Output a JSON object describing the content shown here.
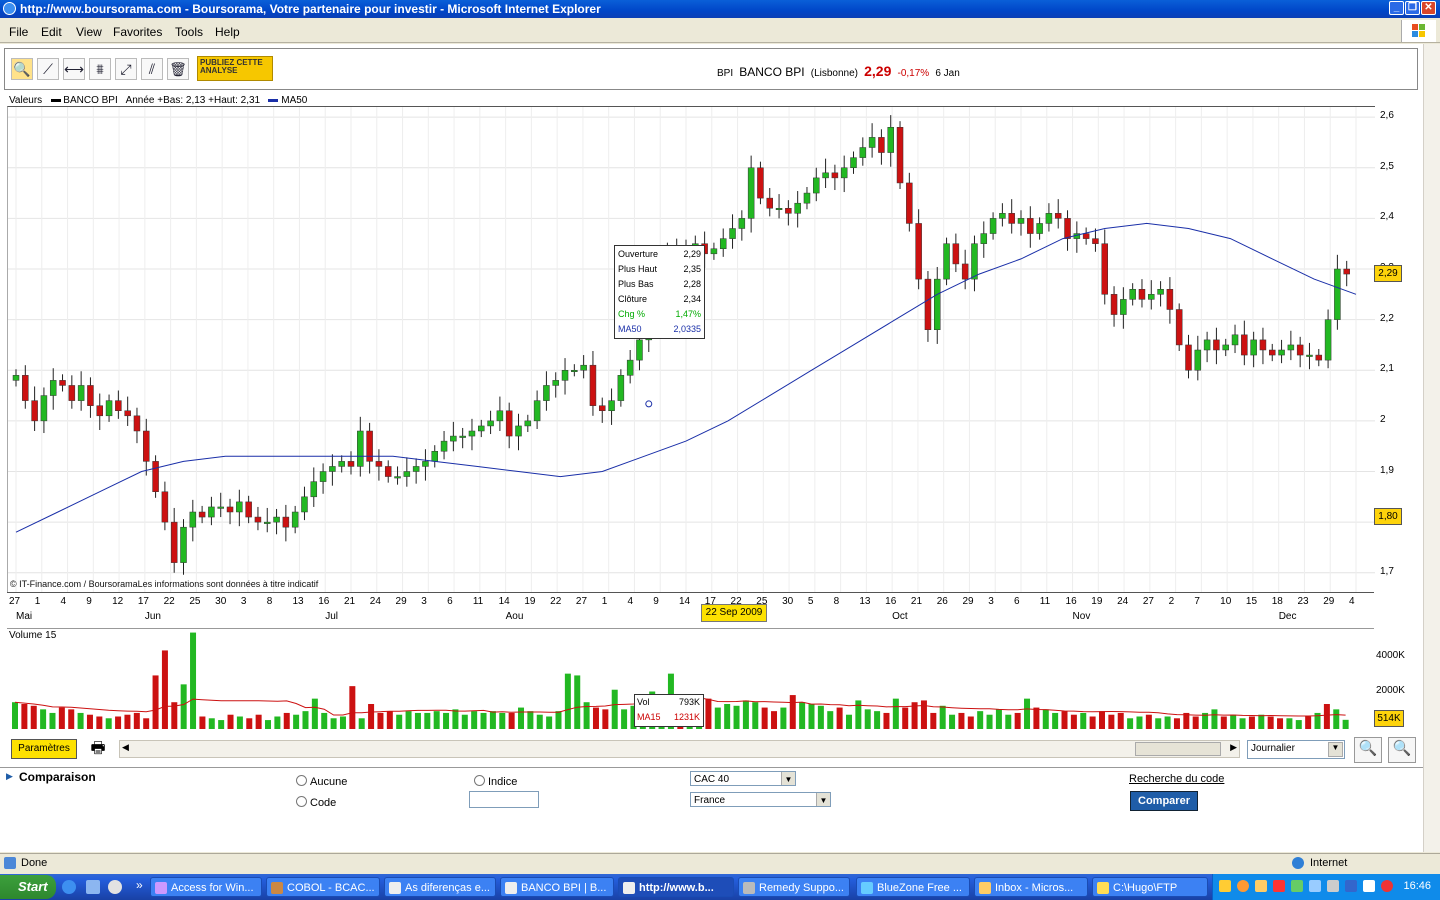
{
  "window": {
    "title": "http://www.boursorama.com - Boursorama, Votre partenaire pour investir - Microsoft Internet Explorer"
  },
  "menu": [
    "File",
    "Edit",
    "View",
    "Favorites",
    "Tools",
    "Help"
  ],
  "toolbar": {
    "publiez_label": "PUBLIEZ CETTE ANALYSE"
  },
  "header": {
    "ticker": "BPI",
    "name": "BANCO BPI",
    "market": "(Lisbonne)",
    "price": "2,29",
    "change": "-0,17%",
    "date": "6 Jan"
  },
  "legend": {
    "valeurs": "Valeurs",
    "series_name": "BANCO BPI",
    "range": "Année +Bas: 2,13 +Haut: 2,31",
    "ma_name": "MA50"
  },
  "copyright": "© IT-Finance.com / BoursoramaLes informations sont données à titre indicatif",
  "tooltip": {
    "rows": [
      {
        "label": "Ouverture",
        "value": "2,29"
      },
      {
        "label": "Plus Haut",
        "value": "2,35"
      },
      {
        "label": "Plus Bas",
        "value": "2,28"
      },
      {
        "label": "Clôture",
        "value": "2,34"
      },
      {
        "label": "Chg %",
        "value": "1,47%"
      },
      {
        "label": "MA50",
        "value": "2,0335"
      }
    ]
  },
  "date_flag": "22 Sep 2009",
  "price_tags": {
    "last": "2,29",
    "low": "1,80"
  },
  "volume": {
    "title": "Volume 15",
    "axis": [
      "4000K",
      "2000K"
    ],
    "tag": "514K",
    "tip_vol_label": "Vol",
    "tip_vol": "793K",
    "tip_ma_label": "MA15",
    "tip_ma": "1231K"
  },
  "chart_data": {
    "type": "candlestick",
    "title": "",
    "y_ticks": [
      "2,6",
      "2,5",
      "2,4",
      "2,3",
      "2,2",
      "2,1",
      "2",
      "1,9",
      "1,8",
      "1,7"
    ],
    "ylim": [
      1.66,
      2.62
    ],
    "x_day_ticks": [
      "27",
      "1",
      "4",
      "9",
      "12",
      "17",
      "22",
      "25",
      "30",
      "3",
      "8",
      "13",
      "16",
      "21",
      "24",
      "29",
      "3",
      "6",
      "11",
      "14",
      "19",
      "22",
      "27",
      "1",
      "4",
      "9",
      "14",
      "17",
      "22",
      "25",
      "30",
      "5",
      "8",
      "13",
      "16",
      "21",
      "26",
      "29",
      "3",
      "6",
      "11",
      "16",
      "19",
      "24",
      "27",
      "2",
      "7",
      "10",
      "15",
      "18",
      "23",
      "29",
      "4"
    ],
    "months": [
      "Mai",
      "Jun",
      "Jul",
      "Aou",
      "Se",
      "Oct",
      "Nov",
      "Dec"
    ],
    "close_series": [
      2.09,
      2.04,
      2.0,
      2.05,
      2.08,
      2.07,
      2.04,
      2.07,
      2.03,
      2.01,
      2.04,
      2.02,
      2.01,
      1.98,
      1.92,
      1.86,
      1.8,
      1.72,
      1.79,
      1.82,
      1.81,
      1.83,
      1.83,
      1.82,
      1.84,
      1.81,
      1.8,
      1.8,
      1.81,
      1.79,
      1.82,
      1.85,
      1.88,
      1.9,
      1.91,
      1.92,
      1.91,
      1.98,
      1.92,
      1.91,
      1.89,
      1.89,
      1.9,
      1.91,
      1.92,
      1.94,
      1.96,
      1.97,
      1.97,
      1.98,
      1.99,
      2.0,
      2.02,
      1.97,
      1.99,
      2.0,
      2.04,
      2.07,
      2.08,
      2.1,
      2.1,
      2.11,
      2.03,
      2.02,
      2.04,
      2.09,
      2.12,
      2.16,
      2.22,
      2.3,
      2.34,
      2.3,
      2.33,
      2.35,
      2.33,
      2.34,
      2.36,
      2.38,
      2.4,
      2.5,
      2.44,
      2.42,
      2.42,
      2.41,
      2.43,
      2.45,
      2.48,
      2.49,
      2.48,
      2.5,
      2.52,
      2.54,
      2.56,
      2.53,
      2.58,
      2.47,
      2.39,
      2.28,
      2.18,
      2.28,
      2.35,
      2.31,
      2.28,
      2.35,
      2.37,
      2.4,
      2.41,
      2.39,
      2.4,
      2.37,
      2.39,
      2.41,
      2.4,
      2.36,
      2.37,
      2.36,
      2.35,
      2.25,
      2.21,
      2.24,
      2.26,
      2.24,
      2.25,
      2.26,
      2.22,
      2.15,
      2.1,
      2.14,
      2.16,
      2.14,
      2.15,
      2.17,
      2.13,
      2.16,
      2.14,
      2.13,
      2.14,
      2.15,
      2.13,
      2.13,
      2.12,
      2.2,
      2.3,
      2.29
    ],
    "ma50_series": [
      1.78,
      1.82,
      1.86,
      1.9,
      1.92,
      1.93,
      1.93,
      1.93,
      1.93,
      1.93,
      1.92,
      1.91,
      1.9,
      1.89,
      1.9,
      1.93,
      1.96,
      2.0,
      2.05,
      2.1,
      2.15,
      2.2,
      2.25,
      2.29,
      2.32,
      2.36,
      2.38,
      2.39,
      2.38,
      2.36,
      2.32,
      2.28,
      2.25
    ],
    "volume_series_k": [
      1500,
      1400,
      1300,
      1100,
      900,
      1200,
      1100,
      900,
      800,
      700,
      600,
      700,
      800,
      900,
      600,
      3000,
      4400,
      1500,
      2500,
      5400,
      700,
      600,
      500,
      800,
      700,
      600,
      800,
      500,
      700,
      900,
      800,
      1000,
      1700,
      900,
      600,
      700,
      2400,
      600,
      1400,
      900,
      1000,
      800,
      1000,
      900,
      900,
      1000,
      900,
      1100,
      800,
      1000,
      900,
      1000,
      900,
      900,
      1200,
      1000,
      800,
      700,
      1000,
      3100,
      3000,
      1500,
      1200,
      1100,
      2200,
      1100,
      1300,
      1500,
      2100,
      1100,
      3100,
      1200,
      1500,
      1300,
      1700,
      1200,
      1400,
      1300,
      1600,
      1500,
      1200,
      1000,
      1200,
      1900,
      1500,
      1400,
      1300,
      1000,
      1200,
      800,
      1600,
      1100,
      1000,
      900,
      1700,
      1200,
      1500,
      1600,
      900,
      1300,
      800,
      900,
      700,
      1000,
      800,
      1100,
      800,
      900,
      1700,
      1200,
      1100,
      900,
      1000,
      800,
      900,
      700,
      1000,
      800,
      900,
      600,
      700,
      800,
      600,
      700,
      600,
      900,
      700,
      900,
      1100,
      700,
      800,
      600,
      700,
      800,
      700,
      600,
      600,
      500,
      700,
      900,
      1400,
      1100,
      514
    ],
    "tooltip_point": {
      "date": "22 Sep 2009",
      "open": 2.29,
      "high": 2.35,
      "low": 2.28,
      "close": 2.34,
      "chg_pct": 1.47,
      "ma50": 2.0335
    },
    "last_price": 2.29,
    "colors": {
      "up": "#22b822",
      "down": "#cc1111",
      "ma50": "#1a2fa8",
      "ma15": "#cc1111"
    }
  },
  "controls": {
    "params": "Paramètres",
    "period": "Journalier"
  },
  "comparison": {
    "title": "Comparaison",
    "radio_aucune": "Aucune",
    "radio_code": "Code",
    "radio_indice": "Indice",
    "index_select": "CAC 40",
    "country_select": "France",
    "recherche": "Recherche du code",
    "comparer": "Comparer"
  },
  "status": {
    "text": "Done",
    "zone": "Internet"
  },
  "taskbar": {
    "start": "Start",
    "tasks": [
      "Access for Win...",
      "COBOL - BCAC...",
      "As diferenças e...",
      "BANCO BPI | B...",
      "http://www.b...",
      "Remedy Suppo...",
      "BlueZone Free ...",
      "Inbox - Micros...",
      "C:\\Hugo\\FTP"
    ],
    "clock": "16:46"
  }
}
